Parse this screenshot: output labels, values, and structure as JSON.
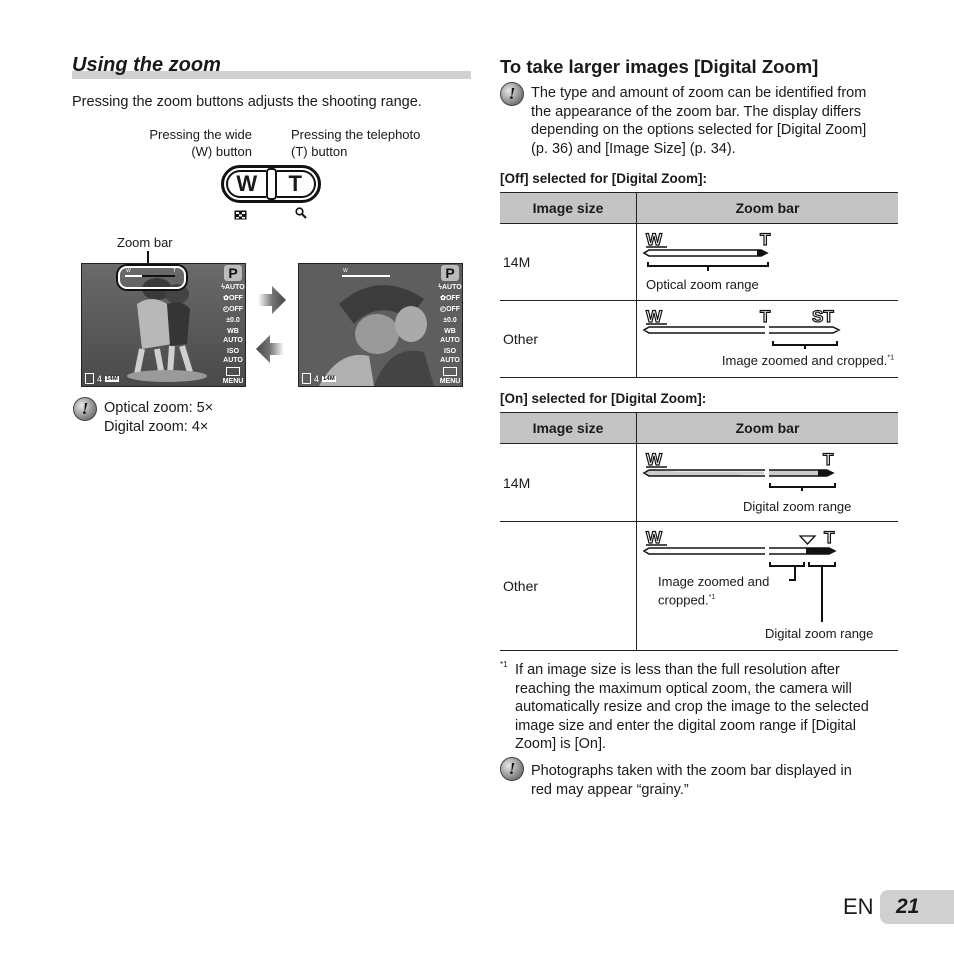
{
  "left": {
    "title": "Using the zoom",
    "intro": "Pressing the zoom buttons adjusts the shooting range.",
    "wide_label_1": "Pressing the wide",
    "wide_label_2": "(W) button",
    "tele_label_1": "Pressing the telephoto",
    "tele_label_2": "(T) button",
    "button_w": "W",
    "button_t": "T",
    "zoom_bar_label": "Zoom bar",
    "screen": {
      "mode": "P",
      "flash": "AUTO",
      "macro": "OFF",
      "self_timer": "OFF",
      "exposure": "±0.0",
      "wb": "WB AUTO",
      "iso": "ISO AUTO",
      "menu": "MENU",
      "shots": "4",
      "size": "14M",
      "zoom_w": "W",
      "zoom_t": "T"
    },
    "note_line1": "Optical zoom: 5×",
    "note_line2": "Digital zoom: 4×"
  },
  "right": {
    "title": "To take larger images [Digital Zoom]",
    "note": "The type and amount of zoom can be identified from the appearance of the zoom bar. The display differs depending on the options selected for [Digital Zoom] (p. 36) and [Image Size] (p. 34).",
    "note_lines": [
      "The type and amount of zoom can be identified from",
      "the appearance of the zoom bar. The display differs",
      "depending on the options selected for [Digital Zoom]",
      "(p. 36) and [Image Size] (p. 34)."
    ],
    "off_heading": "[Off] selected for [Digital Zoom]:",
    "on_heading": "[On] selected for [Digital Zoom]:",
    "col_image_size": "Image size",
    "col_zoom_bar": "Zoom bar",
    "off_rows": [
      {
        "size": "14M",
        "caption": "Optical zoom range"
      },
      {
        "size": "Other",
        "caption": "Image zoomed and cropped.",
        "footnote": "*1"
      }
    ],
    "on_rows": [
      {
        "size": "14M",
        "caption": "Digital zoom range"
      },
      {
        "size": "Other",
        "caption1": "Image zoomed and",
        "caption2": "cropped.",
        "footnote": "*1",
        "caption3": "Digital zoom range"
      }
    ],
    "bar_labels": {
      "w": "W",
      "t": "T",
      "st": "ST"
    },
    "footnote_mark": "*1",
    "footnote_lines": [
      "If an image size is less than the full resolution after",
      "reaching the maximum optical zoom, the camera will",
      "automatically resize and crop the image to the selected",
      "image size and enter the digital zoom range if [Digital",
      "Zoom] is [On]."
    ],
    "warning_lines": [
      "Photographs taken with the zoom bar displayed in",
      "red may appear “grainy.”"
    ]
  },
  "footer": {
    "lang": "EN",
    "page": "21"
  }
}
